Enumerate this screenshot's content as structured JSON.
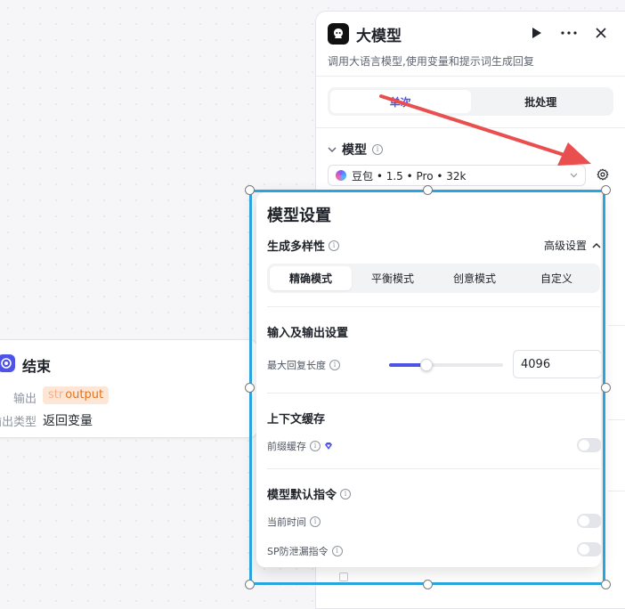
{
  "end_node": {
    "title": "结束",
    "output_label": "输出",
    "output_tag_type": "str",
    "output_tag_name": "output",
    "output_type_label": "输出类型",
    "output_type_value": "返回变量"
  },
  "panel": {
    "title": "大模型",
    "description": "调用大语言模型,使用变量和提示词生成回复",
    "tabs": [
      {
        "label": "单次",
        "active": true
      },
      {
        "label": "批处理",
        "active": false
      }
    ],
    "model_section_label": "模型",
    "model_select_value": "豆包 • 1.5 • Pro • 32k"
  },
  "popup": {
    "title": "模型设置",
    "diversity_label": "生成多样性",
    "advanced_label": "高级设置",
    "modes": [
      {
        "label": "精确模式",
        "active": true
      },
      {
        "label": "平衡模式",
        "active": false
      },
      {
        "label": "创意模式",
        "active": false
      },
      {
        "label": "自定义",
        "active": false
      }
    ],
    "io_section_title": "输入及输出设置",
    "max_reply_label": "最大回复长度",
    "max_reply_value": "4096",
    "max_reply_slider_fraction": 0.33,
    "context_section_title": "上下文缓存",
    "prefix_cache_label": "前缀缓存",
    "prefix_cache_on": false,
    "default_instr_title": "模型默认指令",
    "current_time_label": "当前时间",
    "current_time_on": false,
    "sp_leak_label": "SP防泄漏指令",
    "sp_leak_on": false
  },
  "colors": {
    "accent": "#4d53e8",
    "selection": "#2aa4df",
    "arrow": "#ea4f4f",
    "tag_bg": "#fde6d6",
    "tag_text": "#e5731c"
  }
}
